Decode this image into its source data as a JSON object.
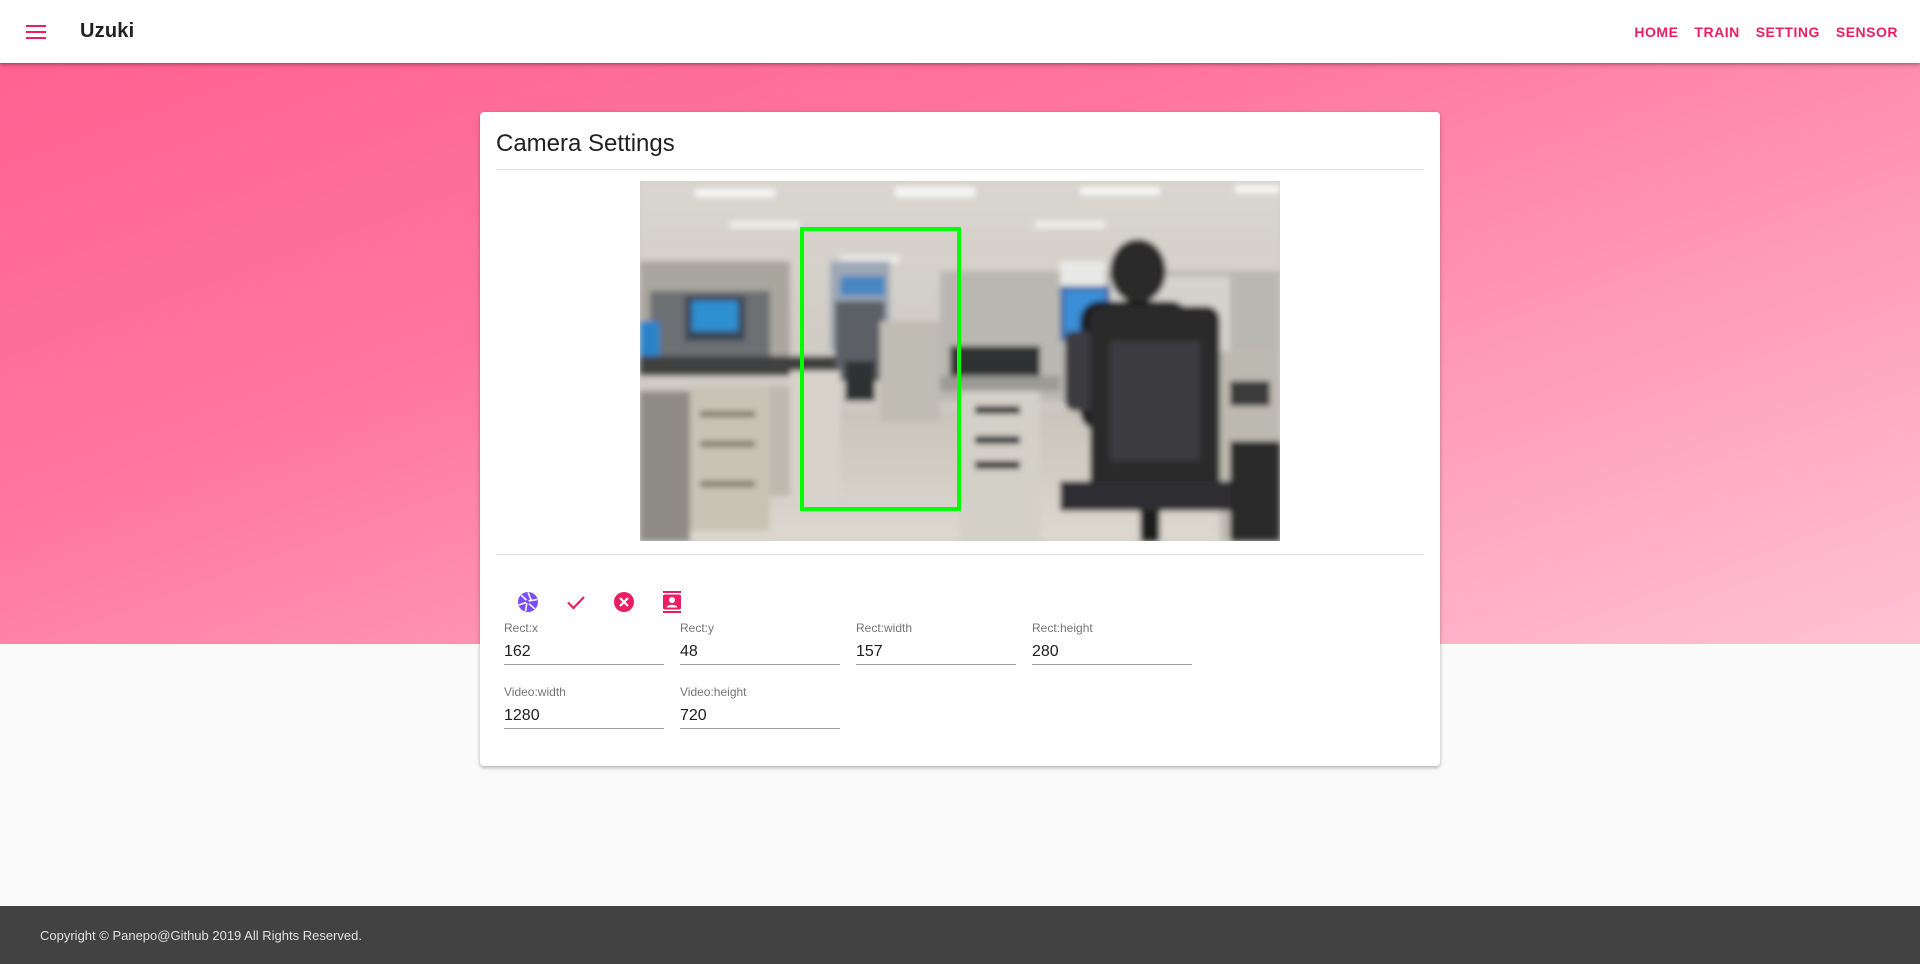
{
  "header": {
    "title": "Uzuki",
    "nav": [
      "HOME",
      "TRAIN",
      "SETTING",
      "SENSOR"
    ],
    "accent_color": "#e91e63"
  },
  "card": {
    "title": "Camera Settings",
    "actions": [
      {
        "icon": "camera-iris-icon",
        "color": "#7c4dff"
      },
      {
        "icon": "check-icon",
        "color": "#e91e63"
      },
      {
        "icon": "close-circle-icon",
        "color": "#e91e63"
      },
      {
        "icon": "account-box-icon",
        "color": "#e91e63"
      }
    ],
    "fields": {
      "rect_x": {
        "label": "Rect:x",
        "value": "162"
      },
      "rect_y": {
        "label": "Rect:y",
        "value": "48"
      },
      "rect_width": {
        "label": "Rect:width",
        "value": "157"
      },
      "rect_height": {
        "label": "Rect:height",
        "value": "280"
      },
      "video_width": {
        "label": "Video:width",
        "value": "1280"
      },
      "video_height": {
        "label": "Video:height",
        "value": "720"
      }
    },
    "detection_rect_color": "#00ff00"
  },
  "footer": {
    "text": "Copyright © Panepo@Github 2019 All Rights Reserved."
  }
}
